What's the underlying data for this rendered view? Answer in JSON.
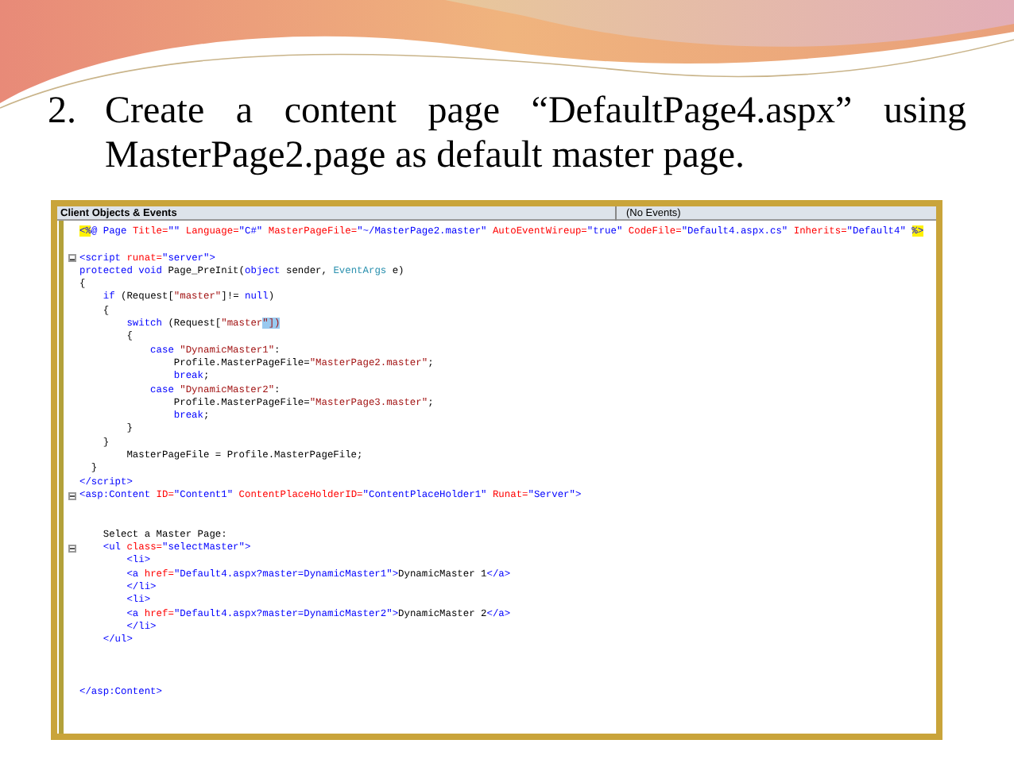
{
  "slide": {
    "number": "2.",
    "text": "Create a content page “DefaultPage4.aspx” using MasterPage2.page as default master page."
  },
  "editor": {
    "object_dropdown": "Client Objects & Events",
    "event_dropdown": "(No Events)",
    "lines": [
      {
        "kind": "code",
        "collapsible": false,
        "tokens": [
          {
            "kind": "mark",
            "text": "<%"
          },
          {
            "kind": "tag",
            "text": "@ Page "
          },
          {
            "kind": "attr",
            "text": "Title="
          },
          {
            "kind": "value",
            "text": "\"\" "
          },
          {
            "kind": "attr",
            "text": "Language="
          },
          {
            "kind": "value",
            "text": "\"C#\" "
          },
          {
            "kind": "attr",
            "text": "MasterPageFile="
          },
          {
            "kind": "value",
            "text": "\"~/MasterPage2.master\" "
          },
          {
            "kind": "attr",
            "text": "AutoEventWireup="
          },
          {
            "kind": "value",
            "text": "\"true\" "
          },
          {
            "kind": "attr",
            "text": "CodeFile="
          },
          {
            "kind": "value",
            "text": "\"Default4.aspx.cs\" "
          },
          {
            "kind": "attr",
            "text": "Inherits="
          },
          {
            "kind": "value",
            "text": "\"Default4\" "
          },
          {
            "kind": "mark",
            "text": "%>"
          }
        ]
      },
      {
        "kind": "blank"
      },
      {
        "kind": "code",
        "collapsible": true,
        "tokens": [
          {
            "kind": "tag",
            "text": "<script "
          },
          {
            "kind": "attr",
            "text": "runat="
          },
          {
            "kind": "value",
            "text": "\"server\""
          },
          {
            "kind": "tag",
            "text": ">"
          }
        ]
      },
      {
        "kind": "code",
        "collapsible": false,
        "tokens": [
          {
            "kind": "keyword",
            "text": "protected void "
          },
          {
            "kind": "plain",
            "text": "Page_PreInit("
          },
          {
            "kind": "keyword",
            "text": "object "
          },
          {
            "kind": "plain",
            "text": "sender, "
          },
          {
            "kind": "type",
            "text": "EventArgs "
          },
          {
            "kind": "plain",
            "text": "e)"
          }
        ]
      },
      {
        "kind": "code",
        "collapsible": false,
        "tokens": [
          {
            "kind": "plain",
            "text": "{"
          }
        ]
      },
      {
        "kind": "code",
        "collapsible": false,
        "tokens": [
          {
            "kind": "keyword",
            "text": "    if "
          },
          {
            "kind": "plain",
            "text": "(Request["
          },
          {
            "kind": "string",
            "text": "\"master\""
          },
          {
            "kind": "plain",
            "text": "]!= "
          },
          {
            "kind": "keyword",
            "text": "null"
          },
          {
            "kind": "plain",
            "text": ")"
          }
        ]
      },
      {
        "kind": "code",
        "collapsible": false,
        "tokens": [
          {
            "kind": "plain",
            "text": "    {"
          }
        ]
      },
      {
        "kind": "code",
        "collapsible": false,
        "tokens": [
          {
            "kind": "keyword",
            "text": "        switch "
          },
          {
            "kind": "plain",
            "text": "(Request["
          },
          {
            "kind": "string",
            "text": "\"master"
          },
          {
            "kind": "selection",
            "text": "\"])"
          }
        ]
      },
      {
        "kind": "code",
        "collapsible": false,
        "tokens": [
          {
            "kind": "plain",
            "text": "        {"
          }
        ]
      },
      {
        "kind": "code",
        "collapsible": false,
        "tokens": [
          {
            "kind": "keyword",
            "text": "            case "
          },
          {
            "kind": "string",
            "text": "\"DynamicMaster1\""
          },
          {
            "kind": "plain",
            "text": ":"
          }
        ]
      },
      {
        "kind": "code",
        "collapsible": false,
        "tokens": [
          {
            "kind": "plain",
            "text": "                Profile.MasterPageFile="
          },
          {
            "kind": "string",
            "text": "\"MasterPage2.master\""
          },
          {
            "kind": "plain",
            "text": ";"
          }
        ]
      },
      {
        "kind": "code",
        "collapsible": false,
        "tokens": [
          {
            "kind": "keyword",
            "text": "                break"
          },
          {
            "kind": "plain",
            "text": ";"
          }
        ]
      },
      {
        "kind": "code",
        "collapsible": false,
        "tokens": [
          {
            "kind": "keyword",
            "text": "            case "
          },
          {
            "kind": "string",
            "text": "\"DynamicMaster2\""
          },
          {
            "kind": "plain",
            "text": ":"
          }
        ]
      },
      {
        "kind": "code",
        "collapsible": false,
        "tokens": [
          {
            "kind": "plain",
            "text": "                Profile.MasterPageFile="
          },
          {
            "kind": "string",
            "text": "\"MasterPage3.master\""
          },
          {
            "kind": "plain",
            "text": ";"
          }
        ]
      },
      {
        "kind": "code",
        "collapsible": false,
        "tokens": [
          {
            "kind": "keyword",
            "text": "                break"
          },
          {
            "kind": "plain",
            "text": ";"
          }
        ]
      },
      {
        "kind": "code",
        "collapsible": false,
        "tokens": [
          {
            "kind": "plain",
            "text": "        }"
          }
        ]
      },
      {
        "kind": "code",
        "collapsible": false,
        "tokens": [
          {
            "kind": "plain",
            "text": "    }"
          }
        ]
      },
      {
        "kind": "code",
        "collapsible": false,
        "tokens": [
          {
            "kind": "plain",
            "text": "        MasterPageFile = Profile.MasterPageFile;"
          }
        ]
      },
      {
        "kind": "code",
        "collapsible": false,
        "tokens": [
          {
            "kind": "plain",
            "text": "  }"
          }
        ]
      },
      {
        "kind": "code",
        "collapsible": false,
        "tokens": [
          {
            "kind": "tag",
            "text": "</script>"
          }
        ]
      },
      {
        "kind": "code",
        "collapsible": true,
        "tokens": [
          {
            "kind": "tag",
            "text": "<asp:Content "
          },
          {
            "kind": "attr",
            "text": "ID="
          },
          {
            "kind": "value",
            "text": "\"Content1\" "
          },
          {
            "kind": "attr",
            "text": "ContentPlaceHolderID="
          },
          {
            "kind": "value",
            "text": "\"ContentPlaceHolder1\" "
          },
          {
            "kind": "attr",
            "text": "Runat="
          },
          {
            "kind": "value",
            "text": "\"Server\""
          },
          {
            "kind": "tag",
            "text": ">"
          }
        ]
      },
      {
        "kind": "blank"
      },
      {
        "kind": "blank"
      },
      {
        "kind": "code",
        "collapsible": false,
        "tokens": [
          {
            "kind": "plain",
            "text": "    Select a Master Page:"
          }
        ]
      },
      {
        "kind": "code",
        "collapsible": true,
        "tokens": [
          {
            "kind": "tag",
            "text": "    <ul "
          },
          {
            "kind": "attr",
            "text": "class="
          },
          {
            "kind": "value",
            "text": "\"selectMaster\""
          },
          {
            "kind": "tag",
            "text": ">"
          }
        ]
      },
      {
        "kind": "code",
        "collapsible": false,
        "tokens": [
          {
            "kind": "tag",
            "text": "        <li>"
          }
        ]
      },
      {
        "kind": "code",
        "collapsible": false,
        "tokens": [
          {
            "kind": "tag",
            "text": "        <a "
          },
          {
            "kind": "attr",
            "text": "href="
          },
          {
            "kind": "value",
            "text": "\"Default4.aspx?master=DynamicMaster1\""
          },
          {
            "kind": "tag",
            "text": ">"
          },
          {
            "kind": "plain",
            "text": "DynamicMaster 1"
          },
          {
            "kind": "tag",
            "text": "</a>"
          }
        ]
      },
      {
        "kind": "code",
        "collapsible": false,
        "tokens": [
          {
            "kind": "tag",
            "text": "        </li>"
          }
        ]
      },
      {
        "kind": "code",
        "collapsible": false,
        "tokens": [
          {
            "kind": "tag",
            "text": "        <li>"
          }
        ]
      },
      {
        "kind": "code",
        "collapsible": false,
        "tokens": [
          {
            "kind": "tag",
            "text": "        <a "
          },
          {
            "kind": "attr",
            "text": "href="
          },
          {
            "kind": "value",
            "text": "\"Default4.aspx?master=DynamicMaster2\""
          },
          {
            "kind": "tag",
            "text": ">"
          },
          {
            "kind": "plain",
            "text": "DynamicMaster 2"
          },
          {
            "kind": "tag",
            "text": "</a>"
          }
        ]
      },
      {
        "kind": "code",
        "collapsible": false,
        "tokens": [
          {
            "kind": "tag",
            "text": "        </li>"
          }
        ]
      },
      {
        "kind": "code",
        "collapsible": false,
        "tokens": [
          {
            "kind": "tag",
            "text": "    </ul>"
          }
        ]
      },
      {
        "kind": "blank"
      },
      {
        "kind": "blank"
      },
      {
        "kind": "blank"
      },
      {
        "kind": "code",
        "collapsible": false,
        "tokens": [
          {
            "kind": "tag",
            "text": "</asp:Content>"
          }
        ]
      }
    ]
  }
}
